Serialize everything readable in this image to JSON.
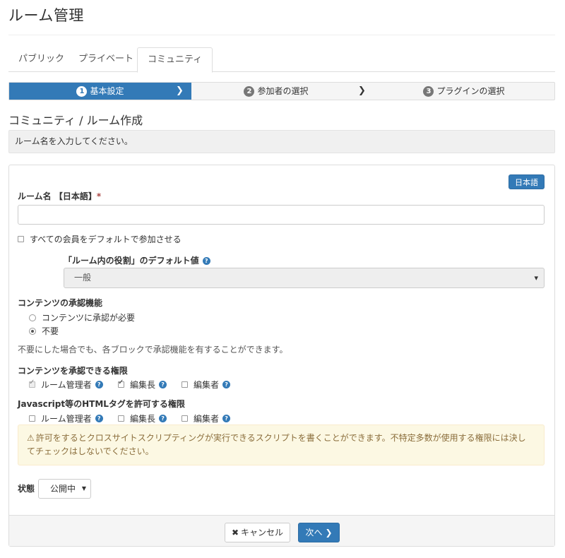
{
  "page_title": "ルーム管理",
  "tabs": [
    {
      "label": "パブリック",
      "active": false
    },
    {
      "label": "プライベート",
      "active": false
    },
    {
      "label": "コミュニティ",
      "active": true
    }
  ],
  "steps": [
    {
      "num": "1",
      "label": "基本設定",
      "active": true
    },
    {
      "num": "2",
      "label": "参加者の選択",
      "active": false
    },
    {
      "num": "3",
      "label": "プラグインの選択",
      "active": false
    }
  ],
  "section_heading": "コミュニティ / ルーム作成",
  "info_message": "ルーム名を入力してください。",
  "form": {
    "language_button": "日本語",
    "room_name_label": "ルーム名 【日本語】",
    "required_mark": "*",
    "room_name_value": "",
    "default_join_label": "すべての会員をデフォルトで参加させる",
    "default_role_label": "「ルーム内の役割」のデフォルト値",
    "default_role_value": "一般",
    "approval_label": "コンテンツの承認機能",
    "approval_options": [
      {
        "label": "コンテンツに承認が必要",
        "checked": false
      },
      {
        "label": "不要",
        "checked": true
      }
    ],
    "approval_help": "不要にした場合でも、各ブロックで承認機能を有することができます。",
    "approver_label": "コンテンツを承認できる権限",
    "approver_roles": [
      {
        "label": "ルーム管理者",
        "checked": true,
        "disabled": true
      },
      {
        "label": "編集長",
        "checked": true,
        "disabled": false
      },
      {
        "label": "編集者",
        "checked": false,
        "disabled": false
      }
    ],
    "html_label": "Javascript等のHTMLタグを許可する権限",
    "html_roles": [
      {
        "label": "ルーム管理者",
        "checked": false
      },
      {
        "label": "編集長",
        "checked": false
      },
      {
        "label": "編集者",
        "checked": false
      }
    ],
    "warning": "許可をするとクロスサイトスクリプティングが実行できるスクリプトを書くことができます。不特定多数が使用する権限には決してチェックはしないでください。",
    "status_label": "状態",
    "status_value": "公開中"
  },
  "buttons": {
    "cancel": "キャンセル",
    "next": "次へ"
  },
  "icons": {
    "help": "question-circle-icon",
    "warning": "warning-triangle-icon",
    "cancel": "close-icon",
    "next": "chevron-right-icon",
    "step_arrow": "chevron-right-icon"
  },
  "colors": {
    "primary": "#337ab7",
    "warning_bg": "#fcf8e3",
    "warning_text": "#8a6d3b",
    "required": "#a94442"
  }
}
